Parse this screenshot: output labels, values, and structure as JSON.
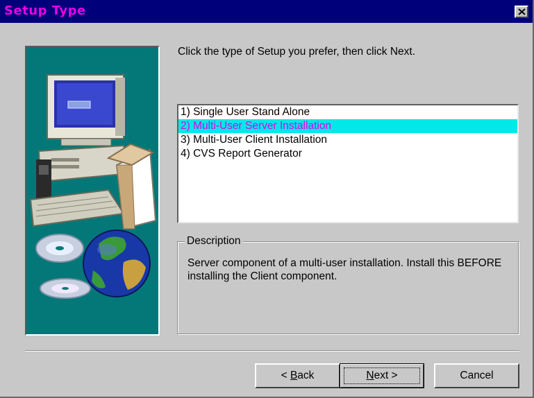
{
  "window": {
    "title": "Setup Type",
    "close_glyph": "×"
  },
  "instruction": "Click the type of Setup you prefer, then click Next.",
  "setup_types": [
    {
      "label": "1) Single User Stand Alone",
      "selected": false
    },
    {
      "label": "2) Multi-User Server Installation",
      "selected": true
    },
    {
      "label": "3) Multi-User Client Installation",
      "selected": false
    },
    {
      "label": "4) CVS Report Generator",
      "selected": false
    }
  ],
  "description": {
    "legend": "Description",
    "text": "Server component of a multi-user installation. Install this BEFORE installing the Client component."
  },
  "buttons": {
    "back_prefix": "< ",
    "back_accel": "B",
    "back_rest": "ack",
    "next_accel": "N",
    "next_rest": "ext >",
    "cancel": "Cancel"
  },
  "colors": {
    "title_bar": "#00007a",
    "title_text": "#e800e8",
    "art_background": "#047878",
    "selection_background": "#00e8e8",
    "selection_text": "#e800e8"
  },
  "icons": {
    "art": "computer-with-cds-and-globe-illustration",
    "close": "close-icon"
  }
}
